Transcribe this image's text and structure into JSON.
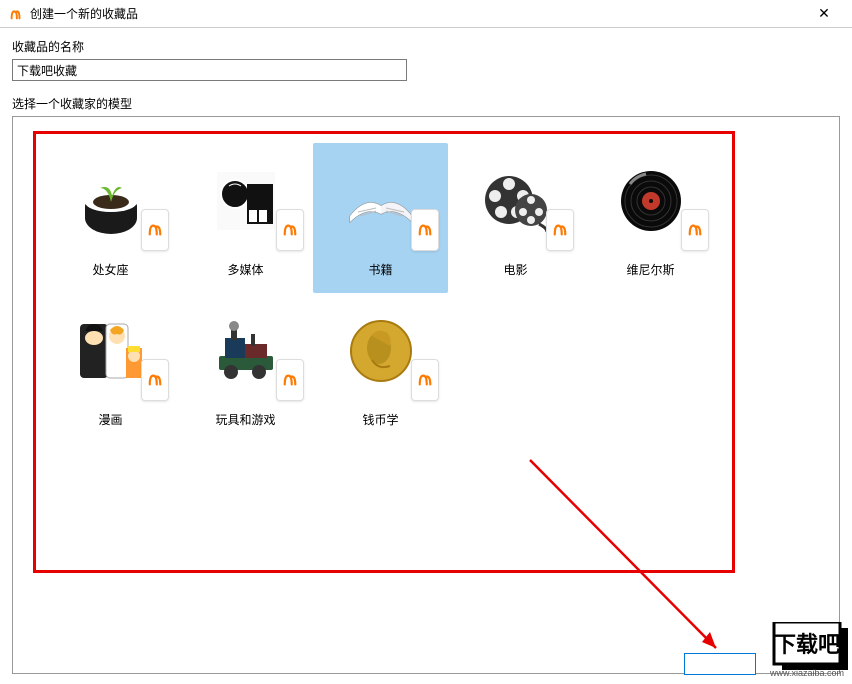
{
  "window": {
    "title": "创建一个新的收藏品"
  },
  "labels": {
    "name": "收藏品的名称",
    "model": "选择一个收藏家的模型"
  },
  "input": {
    "collection_name": "下载吧收藏"
  },
  "models": [
    {
      "label": "处女座",
      "icon": "plant"
    },
    {
      "label": "多媒体",
      "icon": "multimedia"
    },
    {
      "label": "书籍",
      "icon": "book",
      "selected": true
    },
    {
      "label": "电影",
      "icon": "film"
    },
    {
      "label": "维尼尔斯",
      "icon": "vinyl"
    },
    {
      "label": "漫画",
      "icon": "comics"
    },
    {
      "label": "玩具和游戏",
      "icon": "toy"
    },
    {
      "label": "钱币学",
      "icon": "coin"
    }
  ],
  "watermark": {
    "text": "下载吧",
    "url": "www.xiazaiba.com"
  },
  "colors": {
    "accent": "#ff7a00",
    "highlight": "#e60000",
    "selected": "#a6d3f2",
    "ok_border": "#0078d7"
  }
}
